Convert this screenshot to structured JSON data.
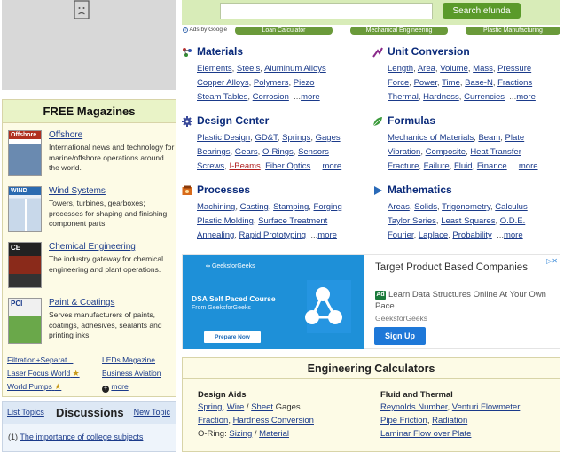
{
  "magazines": {
    "header": "FREE Magazines",
    "items": [
      {
        "title": "Offshore",
        "desc": "International news and technology for marine/offshore operations around the world.",
        "cover_text": "Offshore",
        "cover_color": "#b03020"
      },
      {
        "title": "Wind Systems",
        "desc": "Towers, turbines, gearboxes; processes for shaping and finishing component parts.",
        "cover_text": "WIND",
        "cover_color": "#2a6ab0"
      },
      {
        "title": "Chemical Engineering",
        "desc": "The industry gateway for chemical engineering and plant operations.",
        "cover_text": "CE",
        "cover_color": "#222222"
      },
      {
        "title": "Paint & Coatings",
        "desc": "Serves manufacturers of paints, coatings, adhesives, sealants and printing inks.",
        "cover_text": "PCI",
        "cover_color": "#e8e8e8"
      }
    ],
    "links": [
      [
        "Filtration+Separat...",
        "LEDs Magazine"
      ],
      [
        "Laser Focus World",
        "Business Aviation"
      ],
      [
        "World Pumps",
        "more"
      ]
    ]
  },
  "discussions": {
    "list_label": "List Topics",
    "title": "Discussions",
    "new_label": "New Topic",
    "item_num": "(1)",
    "item_text": "The importance of college subjects"
  },
  "search": {
    "placeholder": "",
    "button": "Search efunda"
  },
  "adrow": {
    "ads_by": "Ads by Google",
    "links": [
      "Loan Calculator",
      "Mechanical Engineering",
      "Plastic Manufacturing"
    ]
  },
  "sections": {
    "materials": {
      "title": "Materials",
      "lines": [
        [
          "Elements",
          "Steels",
          "Aluminum Alloys"
        ],
        [
          "Copper Alloys",
          "Polymers",
          "Piezo"
        ],
        [
          "Steam Tables",
          "Corrosion"
        ]
      ]
    },
    "unit_conversion": {
      "title": "Unit Conversion",
      "lines": [
        [
          "Length",
          "Area",
          "Volume",
          "Mass",
          "Pressure"
        ],
        [
          "Force",
          "Power",
          "Time",
          "Base-N",
          "Fractions"
        ],
        [
          "Thermal",
          "Hardness",
          "Currencies"
        ]
      ]
    },
    "design_center": {
      "title": "Design Center",
      "lines": [
        [
          "Plastic Design",
          "GD&T",
          "Springs",
          "Gages"
        ],
        [
          "Bearings",
          "Gears",
          "O-Rings",
          "Sensors"
        ],
        [
          "Screws",
          "I-Beams",
          "Fiber Optics"
        ]
      ]
    },
    "formulas": {
      "title": "Formulas",
      "lines": [
        [
          "Mechanics of Materials",
          "Beam",
          "Plate"
        ],
        [
          "Vibration",
          "Composite",
          "Heat Transfer"
        ],
        [
          "Fracture",
          "Failure",
          "Fluid",
          "Finance"
        ]
      ]
    },
    "processes": {
      "title": "Processes",
      "lines": [
        [
          "Machining",
          "Casting",
          "Stamping",
          "Forging"
        ],
        [
          "Plastic Molding",
          "Surface Treatment"
        ],
        [
          "Annealing",
          "Rapid Prototyping"
        ]
      ]
    },
    "mathematics": {
      "title": "Mathematics",
      "lines": [
        [
          "Areas",
          "Solids",
          "Trigonometry",
          "Calculus"
        ],
        [
          "Taylor Series",
          "Least Squares",
          "O.D.E."
        ],
        [
          "Fourier",
          "Laplace",
          "Probability"
        ]
      ]
    },
    "more": "more",
    "dots": "..."
  },
  "banner": {
    "logo": "GeeksforGeeks",
    "course_title": "DSA Self Paced Course",
    "course_sub": "From GeeksforGeeks",
    "prepare": "Prepare Now",
    "headline": "Target Product Based Companies",
    "ad_badge": "Ad",
    "desc": "Learn Data Structures Online At Your Own Pace",
    "brand": "GeeksforGeeks",
    "signup": "Sign Up"
  },
  "calculators": {
    "title": "Engineering Calculators",
    "design_aids": {
      "heading": "Design Aids",
      "line1": [
        "Spring",
        "Wire",
        "Sheet",
        "Gages"
      ],
      "line2": [
        "Fraction",
        "Hardness Conversion"
      ],
      "line3_label": "O-Ring:",
      "line3": [
        "Sizing",
        "Material"
      ]
    },
    "fluid": {
      "heading": "Fluid and Thermal",
      "line1": [
        "Reynolds Number",
        "Venturi Flowmeter"
      ],
      "line2": [
        "Pipe Friction",
        "Radiation"
      ],
      "line3": [
        "Laminar Flow over Plate"
      ]
    }
  }
}
